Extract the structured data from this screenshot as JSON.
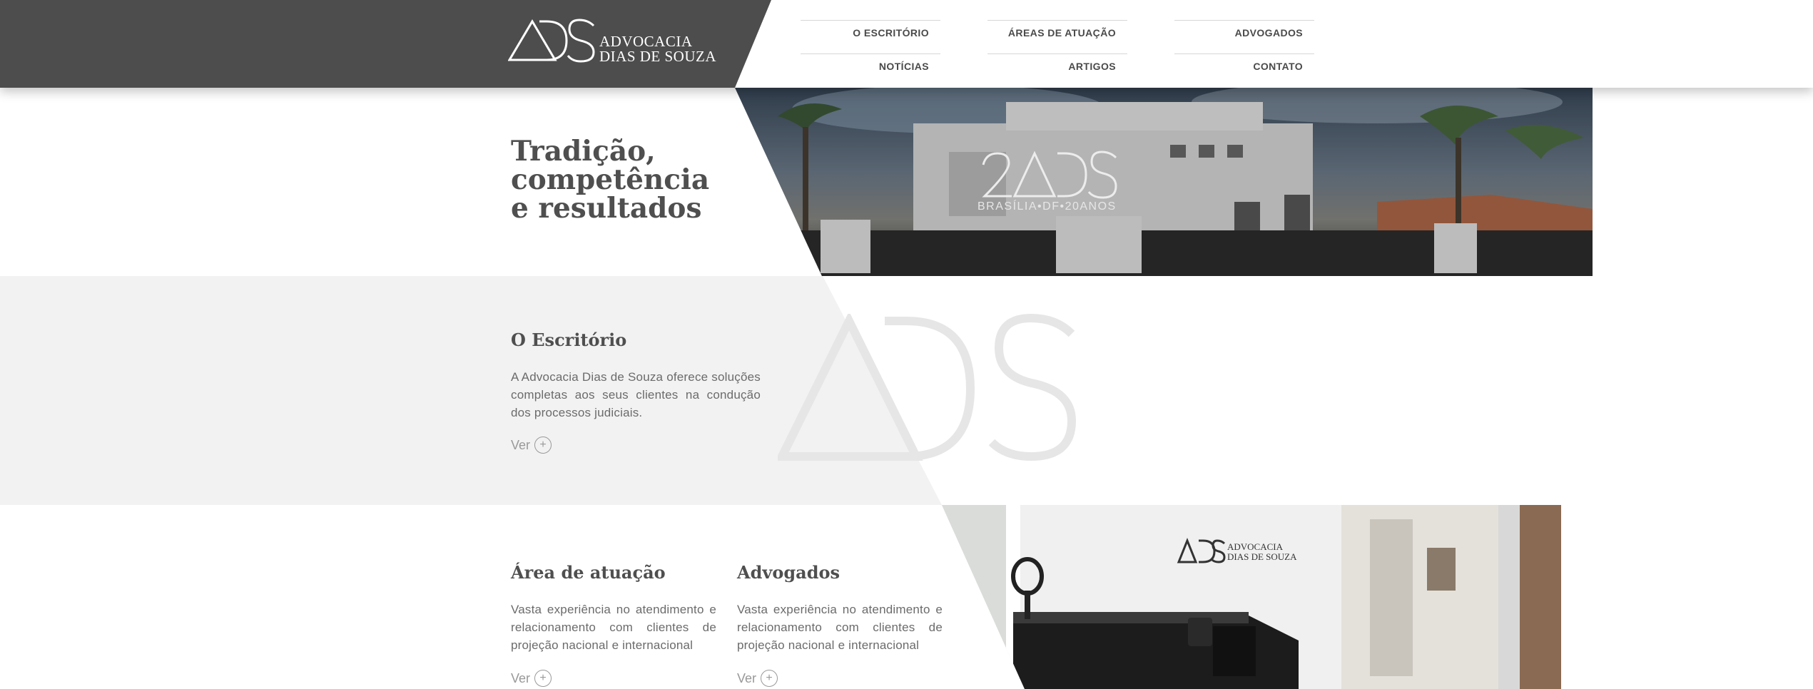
{
  "header": {
    "logo_line1": "ADVOCACIA",
    "logo_line2": "DIAS DE SOUZA",
    "nav": [
      {
        "label": "O ESCRITÓRIO"
      },
      {
        "label": "ÁREAS DE ATUAÇÃO"
      },
      {
        "label": "ADVOGADOS"
      },
      {
        "label": "NOTÍCIAS"
      },
      {
        "label": "ARTIGOS"
      },
      {
        "label": "CONTATO"
      }
    ]
  },
  "hero": {
    "title_line1": "Tradição,",
    "title_line2": "competência",
    "title_line3": "e resultados",
    "badge_line1": "20ADS",
    "badge_line2": "BRASÍLIA•DF•20ANOS"
  },
  "escritorio": {
    "title": "O Escritório",
    "text": "A Advocacia Dias de Souza oferece soluções completas aos seus clientes na condução dos processos judiciais.",
    "link": "Ver"
  },
  "areas": {
    "title": "Área de atuação",
    "text": "Vasta experiência no atendimento e relacionamento com clientes de projeção nacional e internacional",
    "link": "Ver"
  },
  "advogados": {
    "title": "Advogados",
    "text": "Vasta experiência no atendimento e relacionamento com clientes de projeção nacional e internacional",
    "link": "Ver"
  },
  "reception": {
    "sign_line1": "ADVOCACIA",
    "sign_line2": "DIAS DE SOUZA"
  },
  "colors": {
    "header_dark": "#4d4d4d",
    "section_gray": "#f2f2f2",
    "text": "#555555"
  }
}
